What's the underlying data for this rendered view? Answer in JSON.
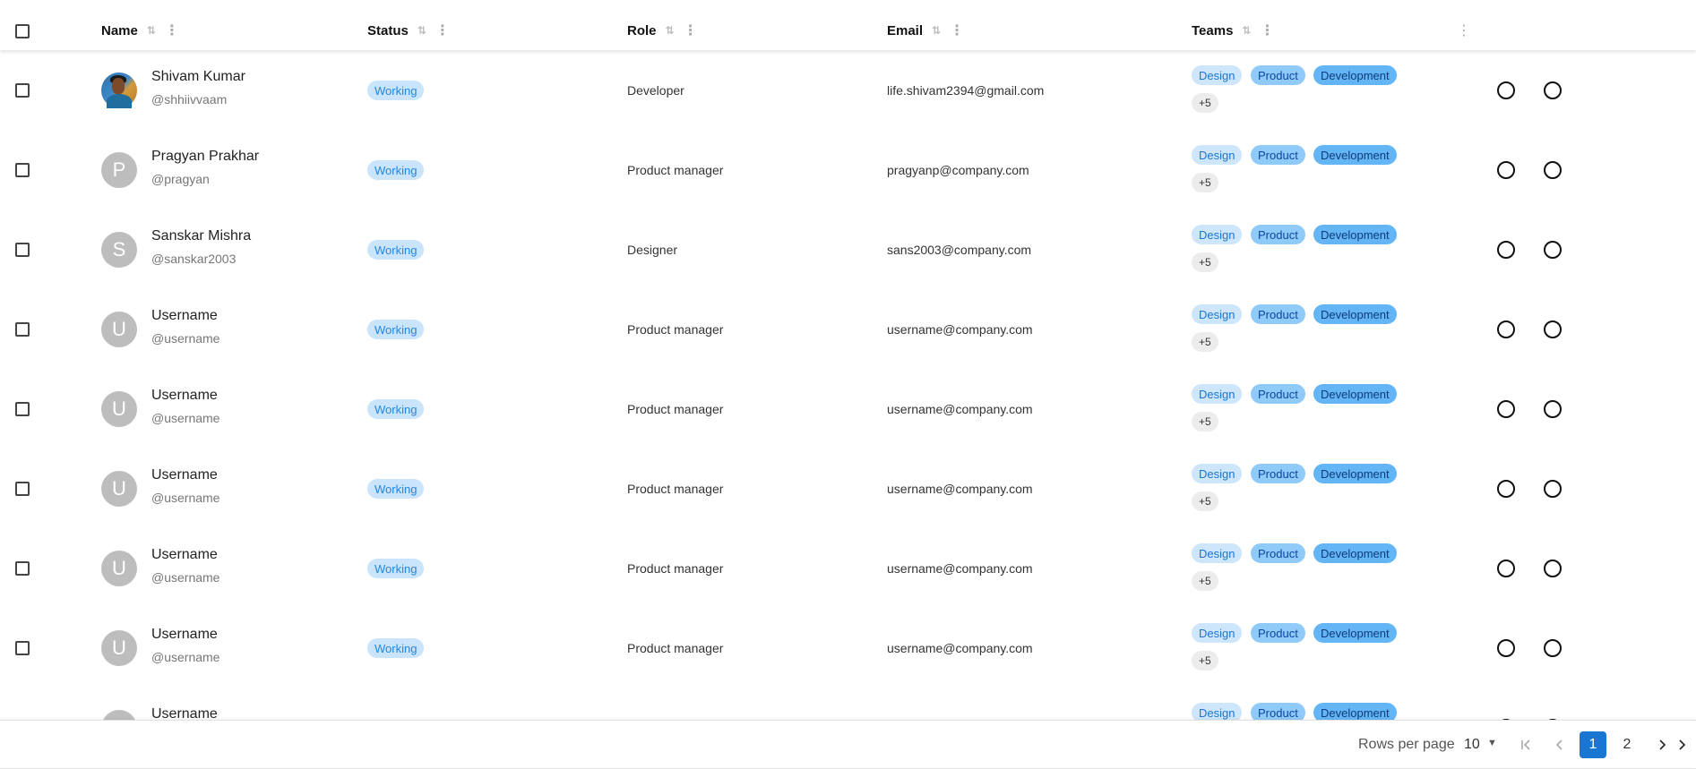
{
  "header": {
    "columns": [
      {
        "label": "Name"
      },
      {
        "label": "Status"
      },
      {
        "label": "Role"
      },
      {
        "label": "Email"
      },
      {
        "label": "Teams"
      }
    ],
    "sort_icon": "⇅",
    "more_icon": "⋮"
  },
  "rows": [
    {
      "name": "Shivam Kumar",
      "handle": "@shhiivvaam",
      "avatar": "",
      "status": "Working",
      "role": "Developer",
      "email": "life.shivam2394@gmail.com",
      "teams": [
        "Design",
        "Product",
        "Development"
      ],
      "more": "+5"
    },
    {
      "name": "Pragyan Prakhar",
      "handle": "@pragyan",
      "avatar": "P",
      "status": "Working",
      "role": "Product manager",
      "email": "pragyanp@company.com",
      "teams": [
        "Design",
        "Product",
        "Development"
      ],
      "more": "+5"
    },
    {
      "name": "Sanskar Mishra",
      "handle": "@sanskar2003",
      "avatar": "S",
      "status": "Working",
      "role": "Designer",
      "email": "sans2003@company.com",
      "teams": [
        "Design",
        "Product",
        "Development"
      ],
      "more": "+5"
    },
    {
      "name": "Username",
      "handle": "@username",
      "avatar": "U",
      "status": "Working",
      "role": "Product manager",
      "email": "username@company.com",
      "teams": [
        "Design",
        "Product",
        "Development"
      ],
      "more": "+5"
    },
    {
      "name": "Username",
      "handle": "@username",
      "avatar": "U",
      "status": "Working",
      "role": "Product manager",
      "email": "username@company.com",
      "teams": [
        "Design",
        "Product",
        "Development"
      ],
      "more": "+5"
    },
    {
      "name": "Username",
      "handle": "@username",
      "avatar": "U",
      "status": "Working",
      "role": "Product manager",
      "email": "username@company.com",
      "teams": [
        "Design",
        "Product",
        "Development"
      ],
      "more": "+5"
    },
    {
      "name": "Username",
      "handle": "@username",
      "avatar": "U",
      "status": "Working",
      "role": "Product manager",
      "email": "username@company.com",
      "teams": [
        "Design",
        "Product",
        "Development"
      ],
      "more": "+5"
    },
    {
      "name": "Username",
      "handle": "@username",
      "avatar": "U",
      "status": "Working",
      "role": "Product manager",
      "email": "username@company.com",
      "teams": [
        "Design",
        "Product",
        "Development"
      ],
      "more": "+5"
    },
    {
      "name": "Username",
      "handle": "",
      "avatar": "U",
      "status": "",
      "role": "",
      "email": "",
      "teams": [
        "Design",
        "Product",
        "Development"
      ],
      "more": ""
    }
  ],
  "footer": {
    "rows_per_page_label": "Rows per page",
    "rows_per_page_value": "10",
    "pages": [
      "1",
      "2"
    ],
    "current_page": "1",
    "icons": {
      "first": "first-page-icon",
      "prev": "chevron-left-icon",
      "next": "chevron-right-icon",
      "last": "last-page-icon",
      "dropdown": "caret-down-icon"
    }
  },
  "colors": {
    "accent": "#1976d2",
    "status_bg": "#c9e4fb",
    "chip_design": "#cde6fb",
    "chip_product": "#90caf9",
    "chip_dev": "#64b5f6"
  }
}
